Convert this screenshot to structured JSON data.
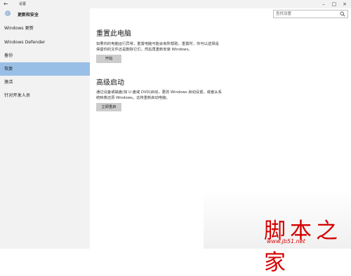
{
  "window": {
    "title": "设置",
    "back_icon": "back-arrow-icon"
  },
  "sidebar": {
    "section_title": "更新和安全",
    "items": [
      {
        "label": "Windows 更新"
      },
      {
        "label": "Windows Defender"
      },
      {
        "label": "备份"
      },
      {
        "label": "恢复",
        "selected": true
      },
      {
        "label": "激活"
      },
      {
        "label": "针对开发人员"
      }
    ]
  },
  "search": {
    "placeholder": "查找设置"
  },
  "reset": {
    "title": "重置此电脑",
    "description": "如果你的电脑运行异常，重置电脑可能会有所帮助。重置时，你可以选择是保留你的文件还是删除它们，然后再重新安装 Windows。",
    "button": "开始"
  },
  "advanced": {
    "title": "高级启动",
    "description": "通过设备或磁盘(如 U 盘或 DVD)启动，更改 Windows 启动设置，或者从系统映像还原 Windows。这将重新启动电脑。",
    "button": "立即重启"
  },
  "watermark": {
    "text": "脚本之家",
    "url": "www.jb51.net"
  },
  "colors": {
    "selected_bg": "#99bfe6",
    "sidebar_bg": "#f2f2f2",
    "button_bg": "#cccccc",
    "watermark": "#d40000"
  }
}
